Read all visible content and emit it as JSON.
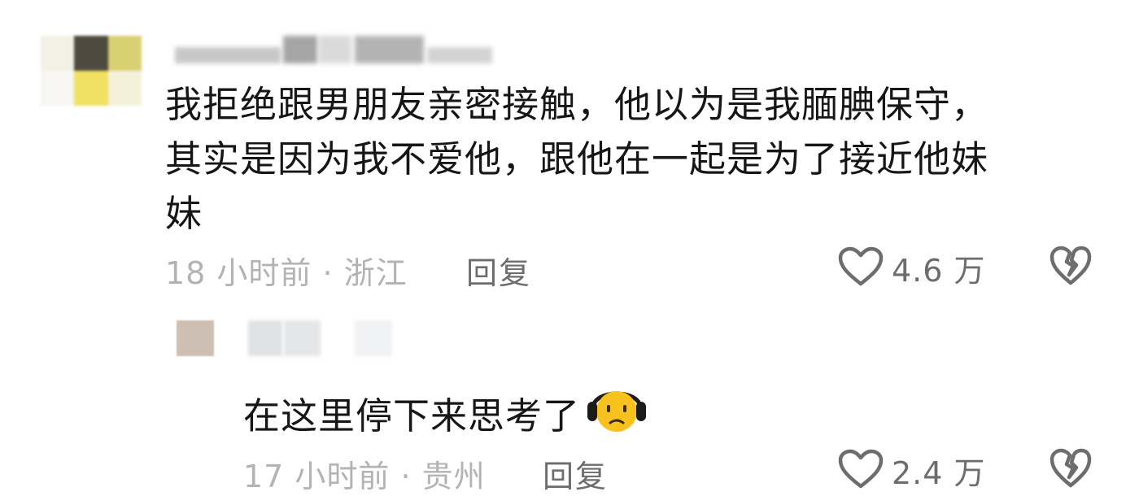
{
  "comment": {
    "text": "我拒绝跟男朋友亲密接触，他以为是我腼腆保守，\n其实是因为我不爱他，跟他在一起是为了接近他妹\n妹",
    "meta": "18 小时前 · 浙江",
    "reply_label": "回复",
    "like_count": "4.6 万",
    "icons": [
      "heart-outline-icon",
      "broken-heart-icon"
    ]
  },
  "reply": {
    "text": "在这里停下来思考了",
    "emoji": "thinking-face-headphones-emoji",
    "meta": "17 小时前 · 贵州",
    "reply_label": "回复",
    "like_count": "2.4 万",
    "icons": [
      "heart-outline-icon",
      "broken-heart-icon"
    ]
  },
  "colors": {
    "text": "#161616",
    "meta": "#b3b3b3",
    "action": "#6d6d6d"
  }
}
